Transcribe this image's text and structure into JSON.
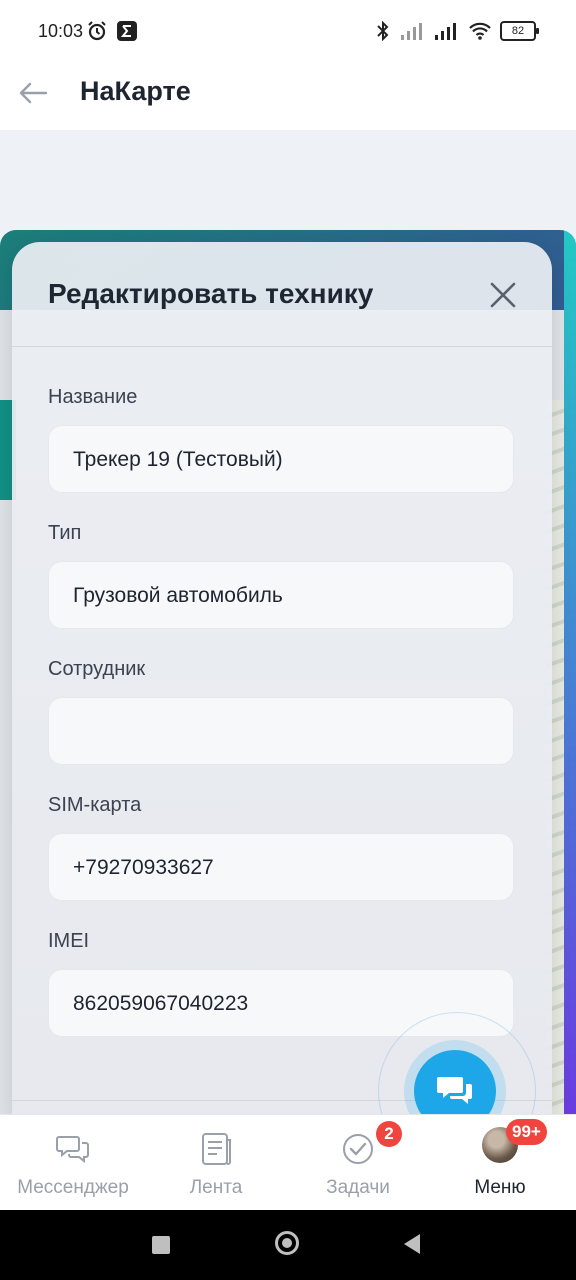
{
  "status_bar": {
    "time": "10:03",
    "battery": "82"
  },
  "header": {
    "title": "НаКарте"
  },
  "dialog": {
    "title": "Редактировать технику",
    "fields": [
      {
        "label": "Название",
        "value": "Трекер 19 (Тестовый)"
      },
      {
        "label": "Тип",
        "value": "Грузовой автомобиль"
      },
      {
        "label": "Сотрудник",
        "value": ""
      },
      {
        "label": "SIM-карта",
        "value": "+79270933627"
      },
      {
        "label": "IMEI",
        "value": "862059067040223"
      }
    ]
  },
  "tabbar": {
    "tabs": [
      {
        "label": "Мессенджер",
        "icon": "chat-bubbles-icon"
      },
      {
        "label": "Лента",
        "icon": "feed-icon"
      },
      {
        "label": "Задачи",
        "icon": "check-circle-icon",
        "badge": "2"
      },
      {
        "label": "Меню",
        "icon": "avatar",
        "badge": "99+"
      }
    ]
  },
  "colors": {
    "accent": "#1ea7e8",
    "badge": "#f0453f",
    "active_tab": "#1e2430",
    "inactive_tab": "#9aa0aa"
  }
}
